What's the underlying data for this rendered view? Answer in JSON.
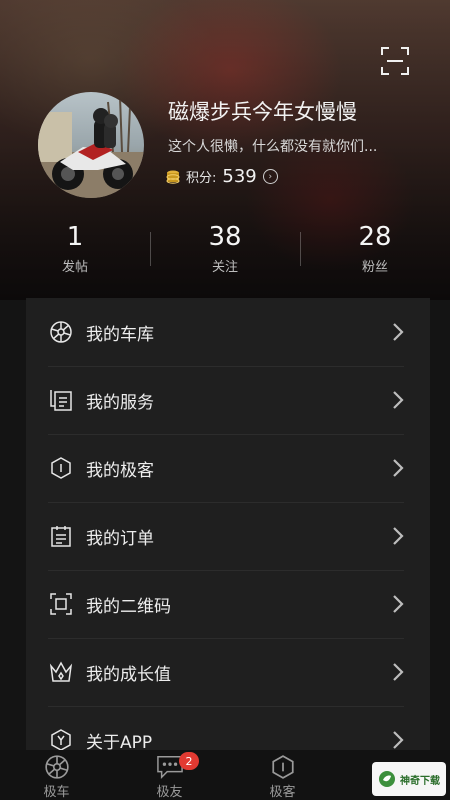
{
  "profile": {
    "username": "磁爆步兵今年女慢慢",
    "bio": "这个人很懒，什么都没有就你们...",
    "points_label": "积分:",
    "points_value": "539"
  },
  "stats": [
    {
      "value": "1",
      "label": "发帖"
    },
    {
      "value": "38",
      "label": "关注"
    },
    {
      "value": "28",
      "label": "粉丝"
    }
  ],
  "menu": [
    {
      "label": "我的车库",
      "icon": "wheel-icon"
    },
    {
      "label": "我的服务",
      "icon": "service-icon"
    },
    {
      "label": "我的极客",
      "icon": "hexagon-info-icon"
    },
    {
      "label": "我的订单",
      "icon": "order-icon"
    },
    {
      "label": "我的二维码",
      "icon": "qrcode-frame-icon"
    },
    {
      "label": "我的成长值",
      "icon": "crown-icon"
    },
    {
      "label": "关于APP",
      "icon": "about-app-icon"
    }
  ],
  "tabs": [
    {
      "label": "极车",
      "icon": "wheel-icon"
    },
    {
      "label": "极友",
      "icon": "chat-icon",
      "badge": "2"
    },
    {
      "label": "极客",
      "icon": "hexagon-icon"
    }
  ],
  "watermark": {
    "text": "神奇下载"
  },
  "colors": {
    "background": "#141414",
    "menu_bg": "#1f1f1f",
    "badge": "#e23a32",
    "coin": "#e2b23a"
  }
}
